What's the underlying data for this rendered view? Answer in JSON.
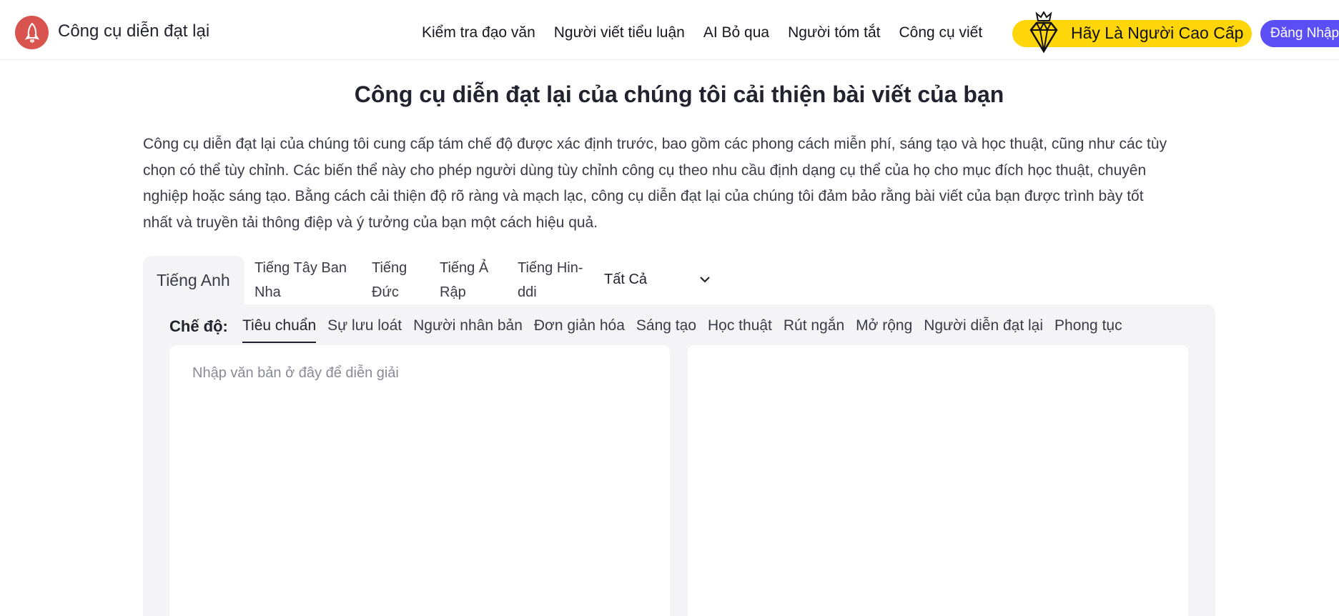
{
  "header": {
    "brand": "Công cụ diễn đạt lại",
    "nav": [
      "Kiểm tra đạo văn",
      "Người viết tiểu luận",
      "AI Bỏ qua",
      "Người tóm tắt",
      "Công cụ viết"
    ],
    "premium_label": "Hãy Là Người Cao Cấp",
    "login_label": "Đăng Nhập"
  },
  "main": {
    "title": "Công cụ diễn đạt lại của chúng tôi cải thiện bài viết của bạn",
    "intro_lines": [
      "Công cụ diễn đạt lại của chúng tôi cung cấp tám chế độ được xác định trước, bao gồm các phong cách miễn phí, sáng tạo và học thuật, cũng như các tùy",
      "chọn có thể tùy chỉnh. Các biến thể này cho phép người dùng tùy chỉnh công cụ theo nhu cầu định dạng cụ thể của họ cho mục đích học thuật, chuyên",
      "nghiệp hoặc sáng tạo. Bằng cách cải thiện độ rõ ràng và mạch lạc, công cụ diễn đạt lại của chúng tôi đảm bảo rằng bài viết của bạn được trình bày tốt",
      "nhất và truyền tải thông điệp và ý tưởng của bạn một cách hiệu quả."
    ]
  },
  "languages": {
    "active": "Tiếng Anh",
    "tabs": [
      {
        "line1": "Tiếng Tây Ban",
        "line2": "Nha"
      },
      {
        "line1": "Tiếng",
        "line2": "Đức"
      },
      {
        "line1": "Tiếng Ả",
        "line2": "Rập"
      },
      {
        "line1": "Tiếng Hin-",
        "line2": "ddi"
      }
    ],
    "select_value": "Tất Cả"
  },
  "modes": {
    "label": "Chế độ:",
    "items": [
      "Tiêu chuẩn",
      "Sự lưu loát",
      "Người nhân bản",
      "Đơn giản hóa",
      "Sáng tạo",
      "Học thuật",
      "Rút ngắn",
      "Mở rộng",
      "Người diễn đạt lại",
      "Phong tục"
    ],
    "active_index": 0
  },
  "editor": {
    "input_placeholder": "Nhập văn bản ở đây để diễn giải",
    "input_value": "",
    "output_value": ""
  },
  "colors": {
    "logo": "#d9534f",
    "premium": "#ffd60a",
    "login": "#5b4ef5",
    "panel": "#f4f4f6"
  },
  "icons": {
    "logo": "rocket-icon",
    "premium": "diamond-crown-icon",
    "select": "chevron-down-icon"
  }
}
